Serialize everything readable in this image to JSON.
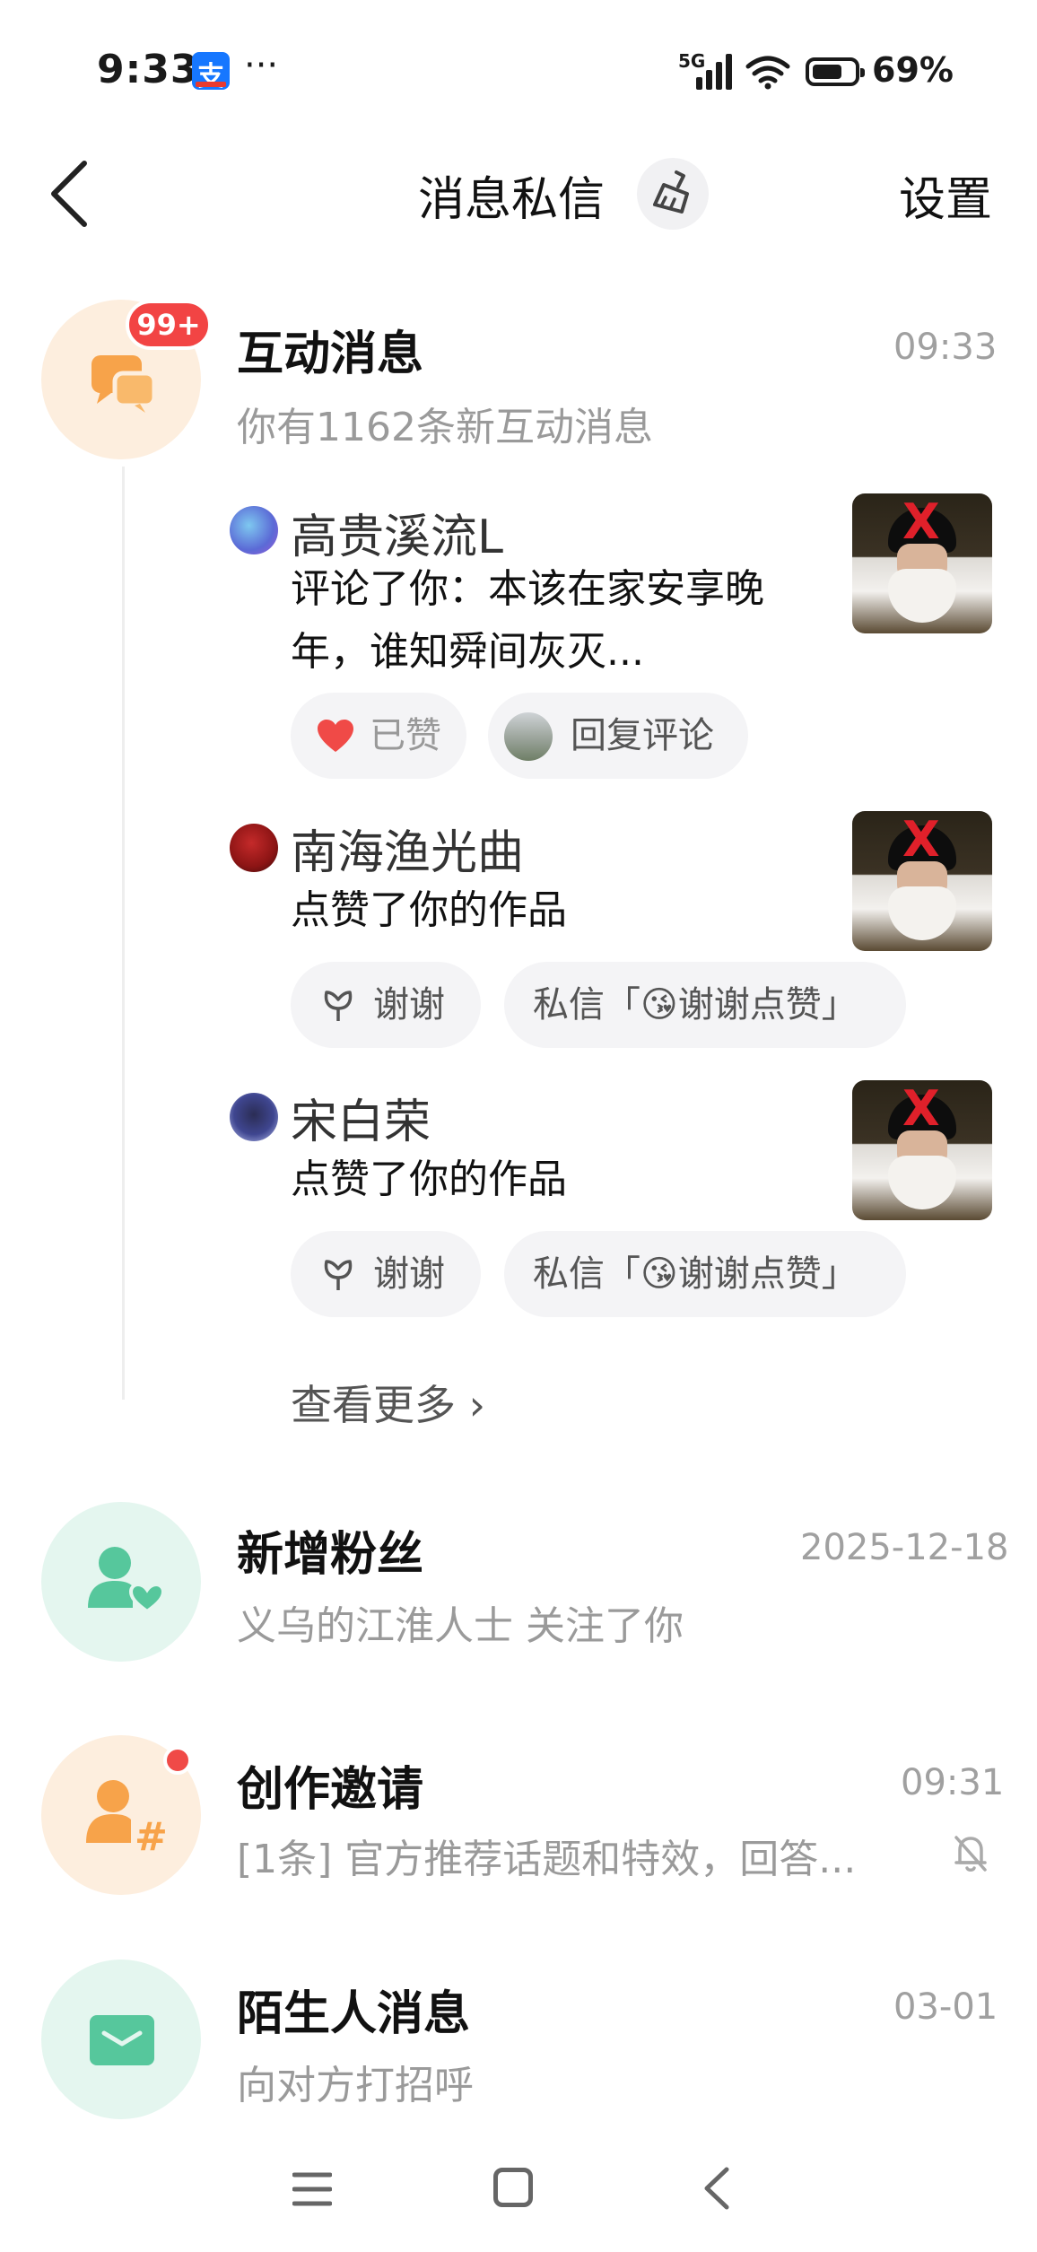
{
  "status_bar": {
    "time": "9:33",
    "alipay_char": "支",
    "more": "···",
    "network": "5G",
    "battery": "69%"
  },
  "header": {
    "title": "消息私信",
    "settings": "设置"
  },
  "interactions": {
    "title": "互动消息",
    "subtitle": "你有1162条新互动消息",
    "time": "09:33",
    "badge": "99+",
    "items": [
      {
        "user": "高贵溪流L",
        "text_line1": "评论了你：本该在家安享晚",
        "text_line2": "年，谁知舜间灰灭...",
        "action1": "已赞",
        "action2": "回复评论"
      },
      {
        "user": "南海渔光曲",
        "text_line1": "点赞了你的作品",
        "action1": "谢谢",
        "action2": "私信「😘谢谢点赞」"
      },
      {
        "user": "宋白荣",
        "text_line1": "点赞了你的作品",
        "action1": "谢谢",
        "action2": "私信「😘谢谢点赞」"
      }
    ],
    "see_more": "查看更多 ›"
  },
  "followers": {
    "title": "新增粉丝",
    "subtitle": "义乌的江淮人士 关注了你",
    "time": "2025-12-18"
  },
  "invites": {
    "title": "创作邀请",
    "subtitle": "[1条] 官方推荐话题和特效，回答...",
    "time": "09:31"
  },
  "strangers": {
    "title": "陌生人消息",
    "subtitle": "向对方打招呼",
    "time": "03-01"
  },
  "colors": {
    "badge_red": "#f24444",
    "peach_bg": "#fdeede",
    "mint_bg": "#e4f6ef",
    "orange_icon": "#f7a34a",
    "green_icon": "#56c79c"
  }
}
